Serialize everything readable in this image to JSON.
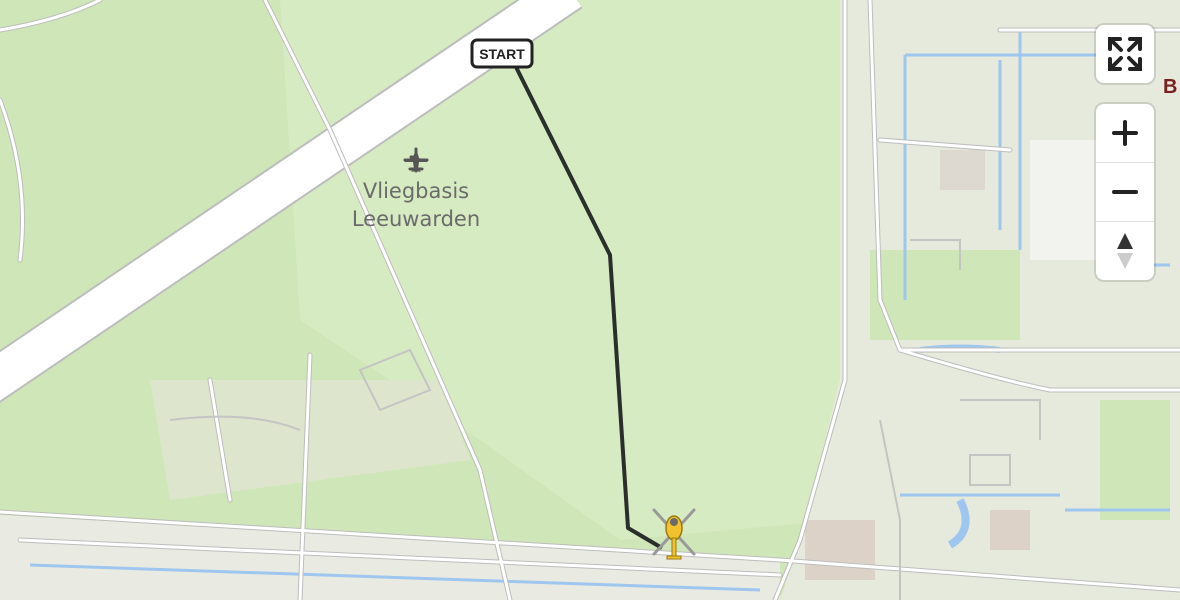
{
  "map": {
    "airport_label_line1": "Vliegbasis",
    "airport_label_line2": "Leeuwarden",
    "start_label": "START",
    "edge_label_partial": "B",
    "airport_icon": "airplane-icon",
    "helicopter_icon": "helicopter-icon"
  },
  "controls": {
    "fullscreen_icon": "expand-icon",
    "zoom_in_icon": "plus-icon",
    "zoom_out_icon": "minus-icon",
    "compass_icon": "north-arrow-icon"
  },
  "colors": {
    "land": "#cfe6b8",
    "urban": "#e9ebe2",
    "road": "#ffffff",
    "road_outline": "#bdbdbd",
    "water": "#9fc6ef",
    "route": "#2b2f2b",
    "helicopter": "#f2c12e"
  }
}
